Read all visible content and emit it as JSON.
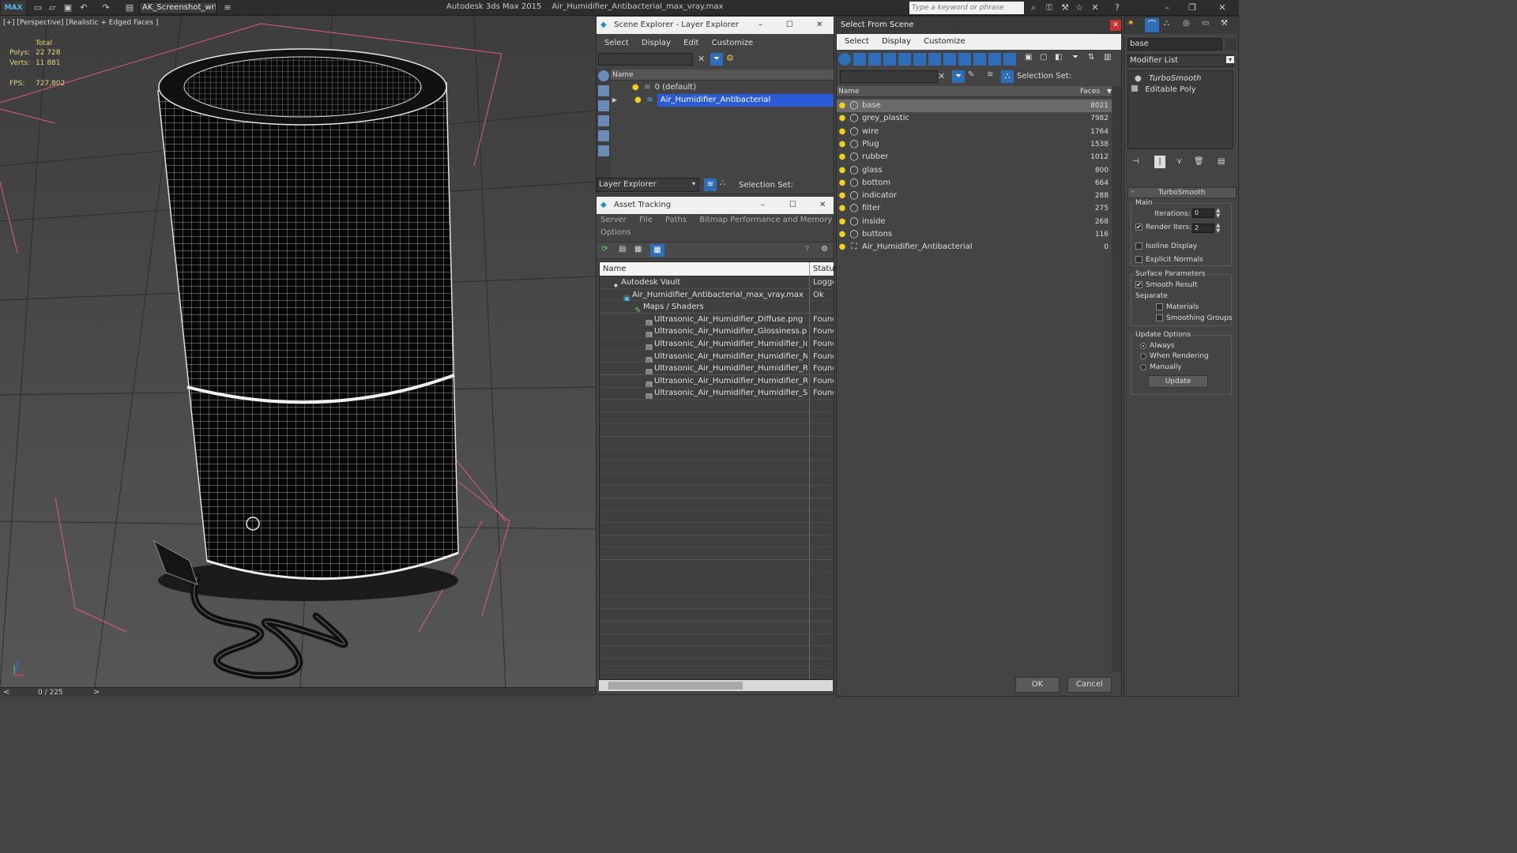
{
  "titlebar": {
    "logo": "MAX",
    "workspace": "AK_Screenshot_wrksp",
    "app_name": "Autodesk 3ds Max  2015",
    "file_name": "Air_Humidifier_Antibacterial_max_vray.max",
    "search_placeholder": "Type a keyword or phrase"
  },
  "viewport": {
    "label": "[+] [Perspective] [Realistic + Edged Faces ]",
    "stats": {
      "total_label": "Total",
      "polys_label": "Polys:",
      "polys_value": "22 728",
      "verts_label": "Verts:",
      "verts_value": "11 881",
      "fps_label": "FPS:",
      "fps_value": "727,802"
    },
    "time_slider": "0 / 225"
  },
  "scene_explorer": {
    "title": "Scene Explorer - Layer Explorer",
    "menu": [
      "Select",
      "Display",
      "Edit",
      "Customize"
    ],
    "column": "Name",
    "layers": [
      {
        "name": "0 (default)",
        "selected": false
      },
      {
        "name": "Air_Humidifier_Antibacterial",
        "selected": true
      }
    ],
    "footer_dropdown": "Layer Explorer",
    "footer_selection": "Selection Set:"
  },
  "asset_tracking": {
    "title": "Asset Tracking",
    "menu": [
      "Server",
      "File",
      "Paths",
      "Bitmap Performance and Memory"
    ],
    "menu2": "Options",
    "col_name": "Name",
    "col_status": "Status",
    "rows": [
      {
        "name": "Autodesk Vault",
        "status": "Logge"
      },
      {
        "name": "Air_Humidifier_Antibacterial_max_vray.max",
        "status": "Ok"
      },
      {
        "name": "Maps / Shaders",
        "status": ""
      },
      {
        "name": "Ultrasonic_Air_Humidifier_Diffuse.png",
        "status": "Found"
      },
      {
        "name": "Ultrasonic_Air_Humidifier_Glossiness.png",
        "status": "Found"
      },
      {
        "name": "Ultrasonic_Air_Humidifier_Humidifier_Ior....",
        "status": "Found"
      },
      {
        "name": "Ultrasonic_Air_Humidifier_Humidifier_Nor...",
        "status": "Found"
      },
      {
        "name": "Ultrasonic_Air_Humidifier_Humidifier_Refr...",
        "status": "Found"
      },
      {
        "name": "Ultrasonic_Air_Humidifier_Humidifier_Refr...",
        "status": "Found"
      },
      {
        "name": "Ultrasonic_Air_Humidifier_Humidifier_Spe...",
        "status": "Found"
      }
    ]
  },
  "select_from_scene": {
    "title": "Select From Scene",
    "menu": [
      "Select",
      "Display",
      "Customize"
    ],
    "selection_set": "Selection Set:",
    "col_name": "Name",
    "col_faces": "Faces",
    "objects": [
      {
        "name": "base",
        "faces": "8021"
      },
      {
        "name": "grey_plastic",
        "faces": "7982"
      },
      {
        "name": "wire",
        "faces": "1764"
      },
      {
        "name": "Plug",
        "faces": "1538"
      },
      {
        "name": "rubber",
        "faces": "1012"
      },
      {
        "name": "glass",
        "faces": "800"
      },
      {
        "name": "bottom",
        "faces": "664"
      },
      {
        "name": "indicator",
        "faces": "288"
      },
      {
        "name": "filter",
        "faces": "275"
      },
      {
        "name": "inside",
        "faces": "268"
      },
      {
        "name": "buttons",
        "faces": "116"
      },
      {
        "name": "Air_Humidifier_Antibacterial",
        "faces": "0"
      }
    ],
    "ok": "OK",
    "cancel": "Cancel"
  },
  "modifier_panel": {
    "object_name": "base",
    "modifier_list": "Modifier List",
    "stack": [
      "TurboSmooth",
      "Editable Poly"
    ],
    "rollout_title": "TurboSmooth",
    "main_label": "Main",
    "iterations_label": "Iterations:",
    "iterations_value": "0",
    "render_iters_label": "Render Iters:",
    "render_iters_value": "2",
    "isoline": "Isoline Display",
    "explicit_normals": "Explicit Normals",
    "surface_params": "Surface Parameters",
    "smooth_result": "Smooth Result",
    "separate": "Separate",
    "materials": "Materials",
    "smoothing_groups": "Smoothing Groups",
    "update_options": "Update Options",
    "always": "Always",
    "when_rendering": "When Rendering",
    "manually": "Manually",
    "update_button": "Update"
  },
  "colors": {
    "selection_blue": "#2a5bd7",
    "stats_yellow": "#e6d37a",
    "bulb_yellow": "#f0d020"
  }
}
